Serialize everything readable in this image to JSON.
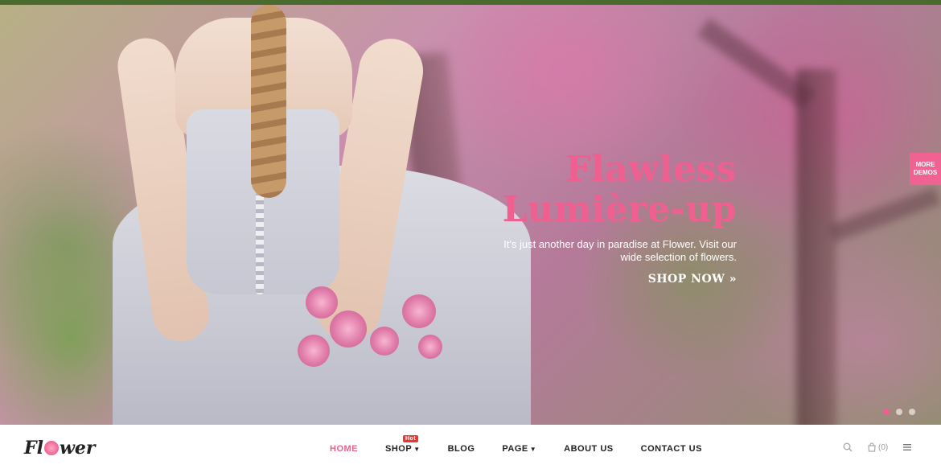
{
  "hero": {
    "title_line1": "Flawless",
    "title_line2": "Lumière-up",
    "text": "It's just another day in paradise at Flower. Visit our wide selection of flowers.",
    "cta": "SHOP NOW »",
    "more_demos_line1": "MORE",
    "more_demos_line2": "DEMOS",
    "slides_total": 3,
    "slide_active": 1
  },
  "nav": {
    "logo_left": "Fl",
    "logo_right": "wer",
    "items": [
      {
        "label": "HOME",
        "active": true
      },
      {
        "label": "SHOP",
        "badge": "Hot",
        "dropdown": true
      },
      {
        "label": "BLOG"
      },
      {
        "label": "PAGE",
        "dropdown": true
      },
      {
        "label": "ABOUT US"
      },
      {
        "label": "CONTACT US"
      }
    ],
    "cart_count": "(0)",
    "icons": [
      "search-icon",
      "bag-icon",
      "menu-icon"
    ]
  },
  "colors": {
    "accent": "#ef5f8f",
    "topbar": "#4a6b2e",
    "hot_badge": "#e53935"
  }
}
